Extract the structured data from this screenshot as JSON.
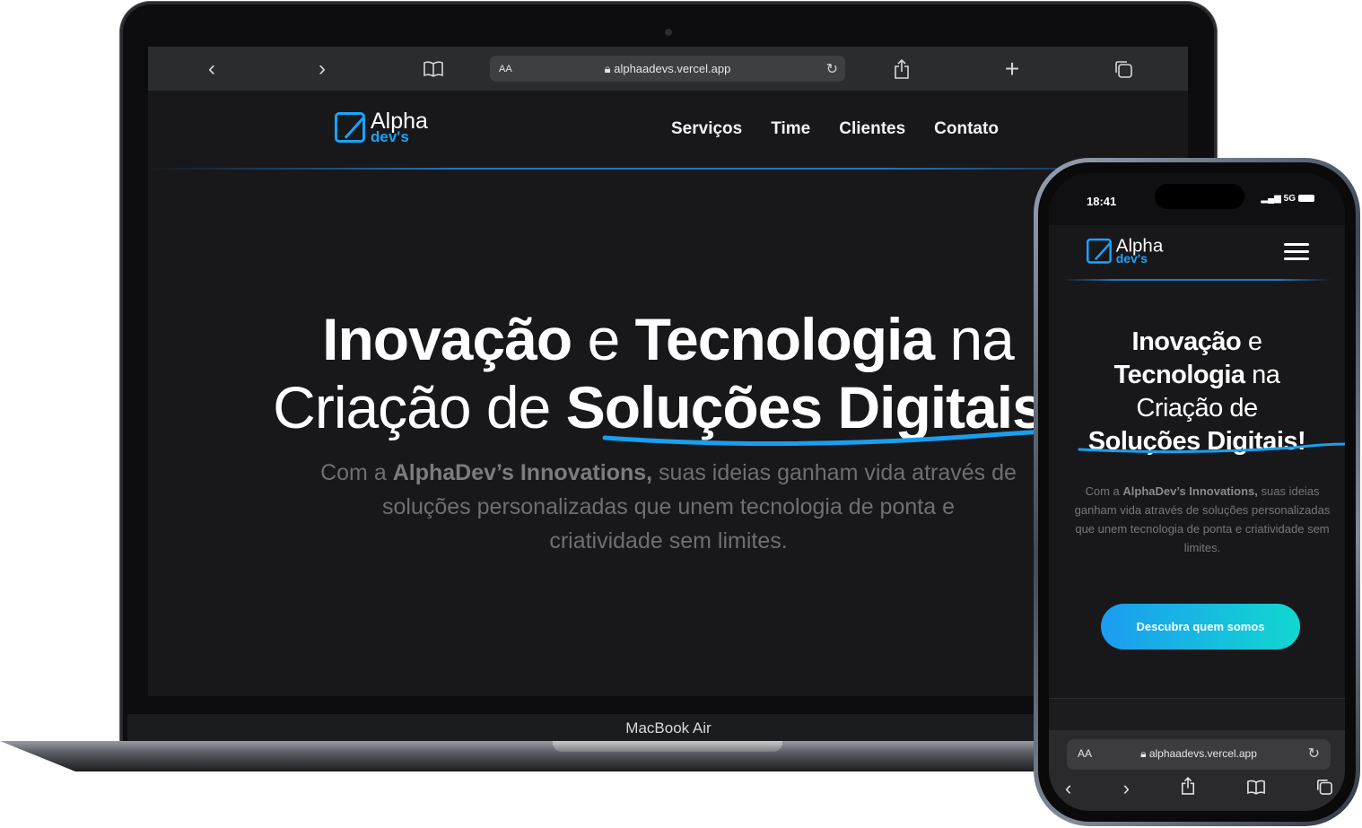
{
  "laptop": {
    "chin_label": "MacBook Air",
    "browser": {
      "back_icon": "chevron-left-icon",
      "forward_icon": "chevron-right-icon",
      "bookmarks_icon": "book-icon",
      "aa": "AA",
      "url": "alphaadevs.vercel.app",
      "share_icon": "share-icon",
      "new_tab": "+",
      "tabs_icon": "tabs-icon"
    },
    "site": {
      "logo_alpha": "Alpha",
      "logo_devs": "dev's",
      "nav": [
        "Serviços",
        "Time",
        "Clientes",
        "Contato"
      ],
      "title_line1": [
        "Inovação",
        "e",
        "Tecnologia",
        "na"
      ],
      "title_line2": [
        "Criação de",
        "Soluções Digitais!"
      ],
      "subtitle_pre": "Com a",
      "subtitle_brand": "AlphaDev’s Innovations,",
      "subtitle_line1_rest": "suas ideias ganham vida através de",
      "subtitle_line2": "soluções personalizadas que unem tecnologia de ponta e",
      "subtitle_line3": "criatividade sem limites."
    }
  },
  "phone": {
    "time": "18:41",
    "network": "5G",
    "logo_alpha": "Alpha",
    "logo_devs": "dev's",
    "title": [
      "Inovação",
      "e",
      "Tecnologia",
      "na",
      "Criação de",
      "Soluções Digitais!"
    ],
    "subtitle_pre": "Com a",
    "subtitle_brand": "AlphaDev’s Innovations,",
    "subtitle_rest": "suas ideias ganham vida através de soluções personalizadas que unem tecnologia de ponta e criatividade sem limites.",
    "cta": "Descubra quem somos",
    "browser": {
      "aa": "AA",
      "url": "alphaadevs.vercel.app",
      "tools": [
        "‹",
        "›",
        "⇪",
        "📖",
        "⧉"
      ]
    }
  },
  "colors": {
    "accent_blue": "#19a4ff",
    "cta_gradient_start": "#1b9cf0",
    "cta_gradient_end": "#12d7d1",
    "page_bg": "#18181a"
  }
}
